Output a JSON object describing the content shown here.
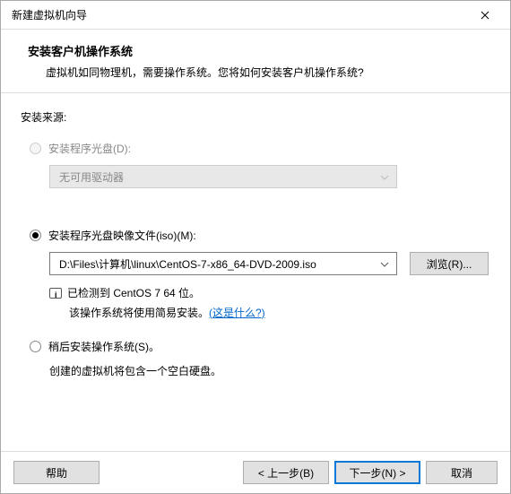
{
  "window": {
    "title": "新建虚拟机向导"
  },
  "header": {
    "title": "安装客户机操作系统",
    "subtitle": "虚拟机如同物理机，需要操作系统。您将如何安装客户机操作系统?"
  },
  "source": {
    "label": "安装来源:"
  },
  "opt_disc": {
    "label": "安装程序光盘(D):",
    "dropdown": "无可用驱动器"
  },
  "opt_iso": {
    "label": "安装程序光盘映像文件(iso)(M):",
    "path": "D:\\Files\\计算机\\linux\\CentOS-7-x86_64-DVD-2009.iso",
    "browse": "浏览(R)...",
    "detected": "已检测到 CentOS 7 64 位。",
    "easy": "该操作系统将使用简易安装。",
    "link": "(这是什么?)"
  },
  "opt_later": {
    "label": "稍后安装操作系统(S)。",
    "hint": "创建的虚拟机将包含一个空白硬盘。"
  },
  "footer": {
    "help": "帮助",
    "back": "< 上一步(B)",
    "next": "下一步(N) >",
    "cancel": "取消"
  }
}
